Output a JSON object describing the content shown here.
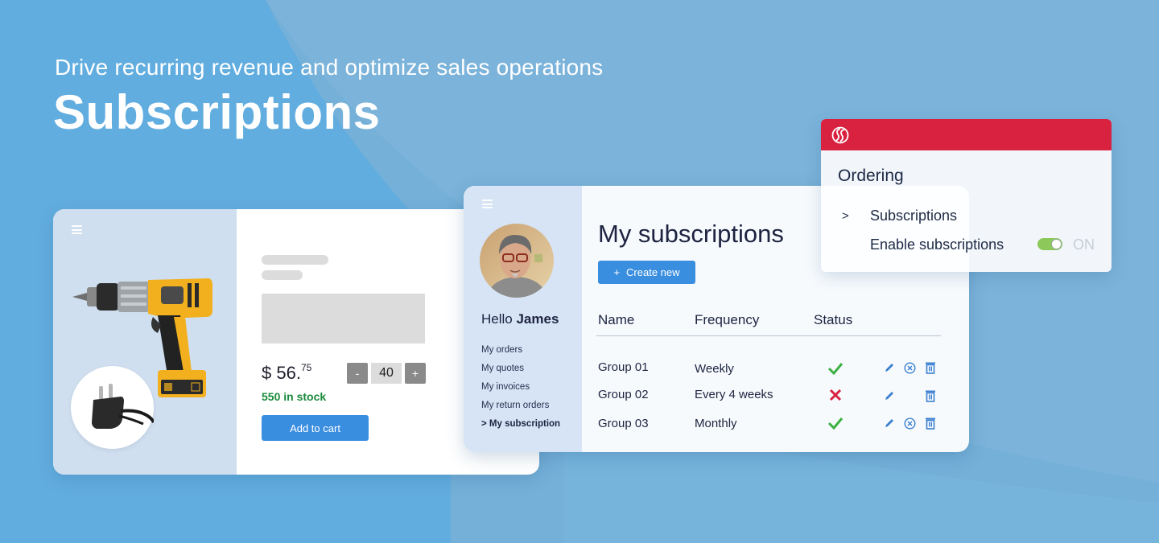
{
  "hero": {
    "subtitle": "Drive recurring revenue and optimize sales operations",
    "title": "Subscriptions"
  },
  "colors": {
    "background": "#74b0d8",
    "accent_blue": "#3a8ee0",
    "brand_red": "#d8223f",
    "stock_green": "#1a8a3c",
    "status_ok": "#3cb043",
    "status_fail": "#d8223f",
    "toggle_on": "#8cc85a"
  },
  "product_card": {
    "menu_icon": "hamburger-icon",
    "product_image": "cordless-drill",
    "accessory_image": "power-plug",
    "price_main": "$ 56.",
    "price_cents": "75",
    "quantity": {
      "decrement_label": "-",
      "value": "40",
      "increment_label": "+"
    },
    "stock_text": "550 in stock",
    "add_to_cart_label": "Add to cart"
  },
  "subscriptions_card": {
    "menu_icon": "hamburger-icon",
    "greeting_prefix": "Hello ",
    "user_name": "James",
    "nav": [
      {
        "label": "My orders",
        "active": false
      },
      {
        "label": "My quotes",
        "active": false
      },
      {
        "label": "My invoices",
        "active": false
      },
      {
        "label": "My return orders",
        "active": false
      },
      {
        "label": "> My subscription",
        "active": true
      }
    ],
    "title": "My subscriptions",
    "create_button": {
      "icon": "+",
      "label": "Create new"
    },
    "table": {
      "columns": [
        "Name",
        "Frequency",
        "Status"
      ],
      "rows": [
        {
          "name": "Group 01",
          "frequency": "Weekly",
          "status": "active",
          "actions": [
            "edit",
            "cancel",
            "delete"
          ]
        },
        {
          "name": "Group 02",
          "frequency": "Every 4 weeks",
          "status": "inactive",
          "actions": [
            "edit",
            "delete"
          ]
        },
        {
          "name": "Group 03",
          "frequency": "Monthly",
          "status": "active",
          "actions": [
            "edit",
            "cancel",
            "delete"
          ]
        }
      ]
    }
  },
  "ordering_panel": {
    "logo_icon": "ss-logo-icon",
    "title": "Ordering",
    "nav_arrow": ">",
    "item": "Subscriptions",
    "setting_label": "Enable subscriptions",
    "toggle_state": "ON"
  }
}
